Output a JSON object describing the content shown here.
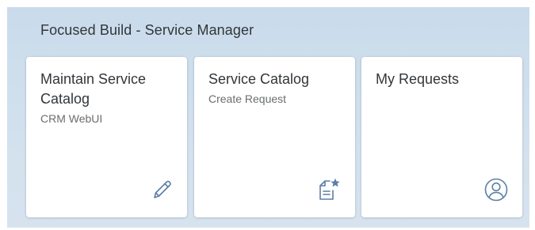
{
  "group": {
    "title": "Focused Build - Service Manager"
  },
  "tiles": [
    {
      "title": "Maintain Service Catalog",
      "subtitle": "CRM WebUI",
      "icon": "edit-pencil-icon"
    },
    {
      "title": "Service Catalog",
      "subtitle": "Create Request",
      "icon": "document-star-icon"
    },
    {
      "title": "My Requests",
      "subtitle": "",
      "icon": "user-circle-icon"
    }
  ],
  "colors": {
    "group_background": "#d0dfec",
    "tile_background": "#ffffff",
    "icon_color": "#5b7fa6",
    "title_text": "#32363a",
    "subtitle_text": "#6a6d70"
  }
}
